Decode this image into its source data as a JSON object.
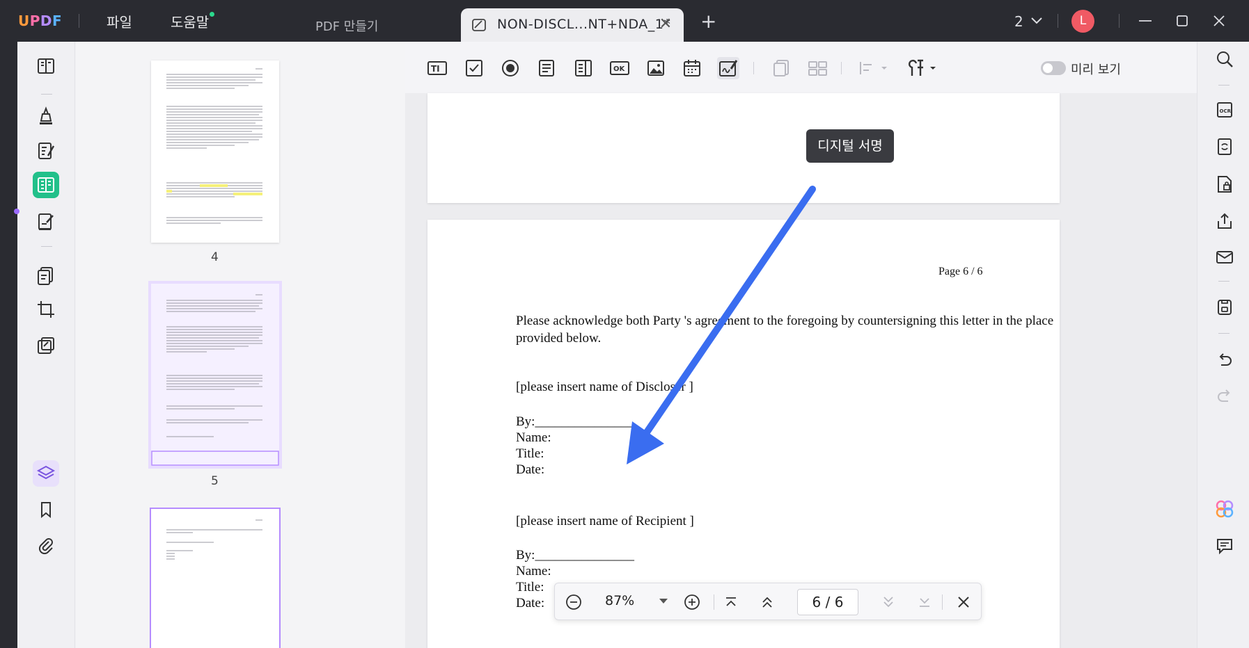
{
  "app": {
    "logo": {
      "u": "U",
      "p": "P",
      "d": "D",
      "f": "F"
    },
    "menu": {
      "file": "파일",
      "help": "도움말"
    },
    "tabs": {
      "inactive": "PDF 만들기",
      "active": "NON-DISCL...NT+NDA_1*",
      "count": "2"
    },
    "avatar": "L"
  },
  "toolbar": {
    "preview_label": "미리 보기",
    "tooltip": "디지털 서명",
    "tools": [
      "text-field-icon",
      "checkbox-icon",
      "radio-button-icon",
      "list-box-icon",
      "dropdown-icon",
      "button-icon",
      "image-field-icon",
      "date-field-icon",
      "digital-signature-icon"
    ]
  },
  "thumbnails": [
    {
      "number": "4"
    },
    {
      "number": "5"
    }
  ],
  "document": {
    "page_label": "Page  6 / 6",
    "ack_line1": "Please acknowledge both Party 's agreement to the foregoing by countersigning this letter in the place",
    "ack_line2": "provided below.",
    "discloser": "[please insert name of Discloser ]",
    "by": " By:_______________",
    "name": "Name:",
    "title": "Title:",
    "date": "Date:",
    "recipient": "[please insert name of Recipient ]",
    "by2": " By:_______________",
    "name2": "Name:",
    "title2": "Title:",
    "date2": "Date:"
  },
  "pagenav": {
    "zoom": "87%",
    "page": "6  /  6"
  },
  "colors": {
    "accent_green": "#22c08a",
    "arrow_blue": "#3a6df0",
    "selection_purple": "#b58cff"
  }
}
